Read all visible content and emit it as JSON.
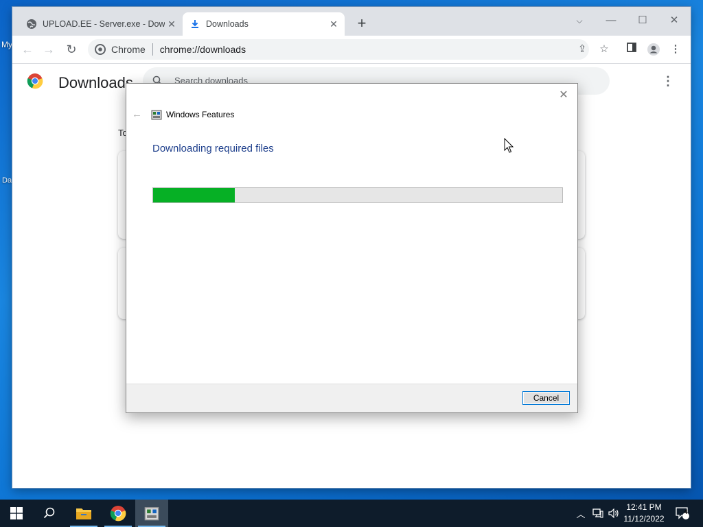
{
  "desktop": {
    "icon_labels": [
      "My",
      "Da"
    ]
  },
  "browser": {
    "tabs": [
      {
        "title": "UPLOAD.EE - Server.exe - Downlo",
        "active": false,
        "icon": "globe-icon"
      },
      {
        "title": "Downloads",
        "active": true,
        "icon": "download-icon"
      }
    ],
    "omnibox": {
      "chip_label": "Chrome",
      "url": "chrome://downloads"
    }
  },
  "downloads_page": {
    "title": "Downloads",
    "search_placeholder": "Search downloads",
    "date_group_label": "To"
  },
  "dialog": {
    "title": "Windows Features",
    "heading": "Downloading required files",
    "progress_fraction": 0.2,
    "cancel_label": "Cancel"
  },
  "taskbar": {
    "apps": [
      "start-icon",
      "search-icon",
      "file-explorer-icon",
      "chrome-icon",
      "windows-features-icon"
    ],
    "time": "12:41 PM",
    "date": "11/12/2022",
    "notification_count": "4"
  },
  "colors": {
    "progress_fill": "#06b025",
    "dialog_heading": "#1e3f8c",
    "taskbar": "#0e1c2b"
  }
}
